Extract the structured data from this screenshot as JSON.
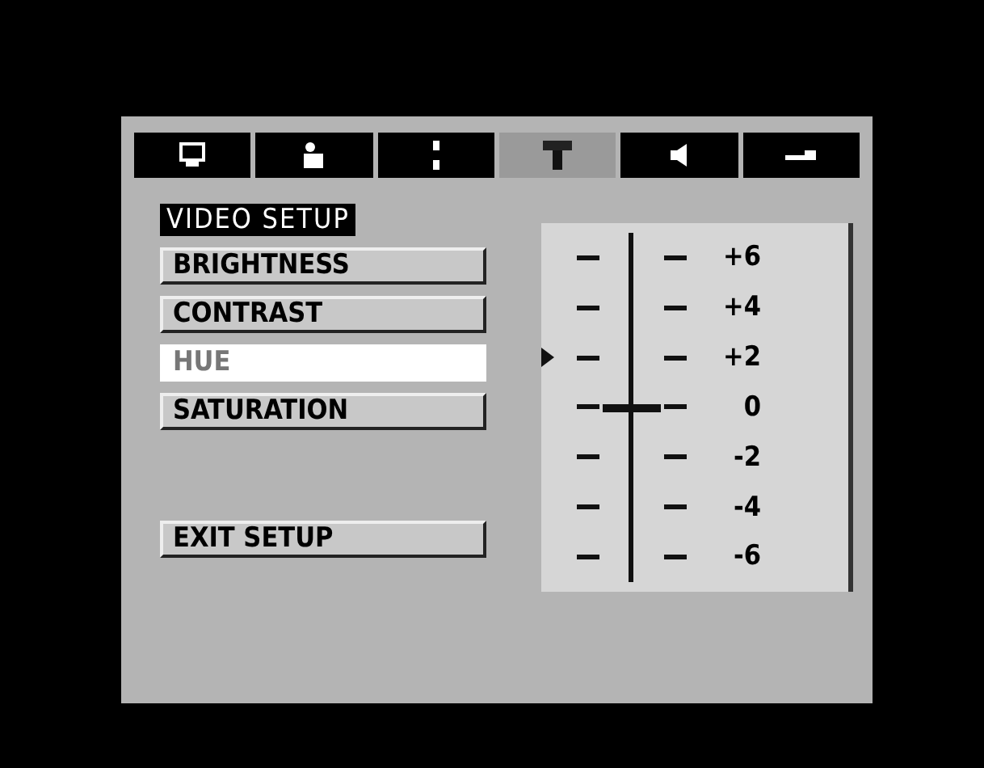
{
  "tabs": [
    {
      "selected": false
    },
    {
      "selected": false
    },
    {
      "selected": false
    },
    {
      "selected": true
    },
    {
      "selected": false
    },
    {
      "selected": false
    }
  ],
  "menu": {
    "title": "VIDEO SETUP",
    "items": [
      {
        "label": "BRIGHTNESS",
        "kind": "setting",
        "selected": false
      },
      {
        "label": "CONTRAST",
        "kind": "setting",
        "selected": false
      },
      {
        "label": "HUE",
        "kind": "setting",
        "selected": true
      },
      {
        "label": "SATURATION",
        "kind": "setting",
        "selected": false
      },
      {
        "label": "EXIT SETUP",
        "kind": "action",
        "selected": false
      }
    ]
  },
  "slider": {
    "level": 0.5,
    "scale": [
      "+6",
      "+4",
      "+2",
      "0",
      "-2",
      "-4",
      "-6"
    ]
  }
}
